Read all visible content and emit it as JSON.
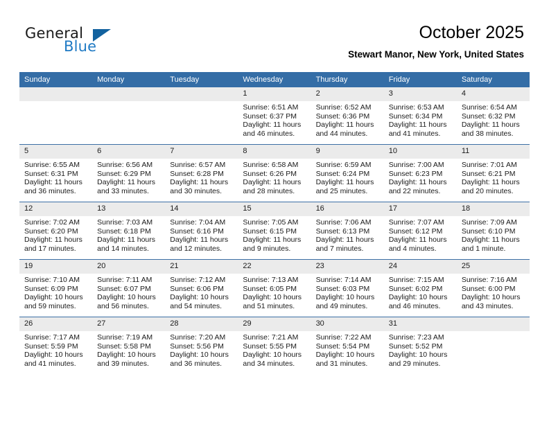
{
  "brand": {
    "word_general": "General",
    "word_blue": "Blue",
    "triangle_color": "#12629f",
    "blue_color": "#1f7ac4"
  },
  "header": {
    "title": "October 2025",
    "location": "Stewart Manor, New York, United States"
  },
  "colors": {
    "header_row_bg": "#346DA6",
    "daynum_bg": "#ebebeb",
    "row_divider": "#3b6ea5"
  },
  "weekdays": [
    "Sunday",
    "Monday",
    "Tuesday",
    "Wednesday",
    "Thursday",
    "Friday",
    "Saturday"
  ],
  "weeks": [
    [
      {
        "day": "",
        "sunrise": "",
        "sunset": "",
        "daylight1": "",
        "daylight2": ""
      },
      {
        "day": "",
        "sunrise": "",
        "sunset": "",
        "daylight1": "",
        "daylight2": ""
      },
      {
        "day": "",
        "sunrise": "",
        "sunset": "",
        "daylight1": "",
        "daylight2": ""
      },
      {
        "day": "1",
        "sunrise": "Sunrise: 6:51 AM",
        "sunset": "Sunset: 6:37 PM",
        "daylight1": "Daylight: 11 hours",
        "daylight2": "and 46 minutes."
      },
      {
        "day": "2",
        "sunrise": "Sunrise: 6:52 AM",
        "sunset": "Sunset: 6:36 PM",
        "daylight1": "Daylight: 11 hours",
        "daylight2": "and 44 minutes."
      },
      {
        "day": "3",
        "sunrise": "Sunrise: 6:53 AM",
        "sunset": "Sunset: 6:34 PM",
        "daylight1": "Daylight: 11 hours",
        "daylight2": "and 41 minutes."
      },
      {
        "day": "4",
        "sunrise": "Sunrise: 6:54 AM",
        "sunset": "Sunset: 6:32 PM",
        "daylight1": "Daylight: 11 hours",
        "daylight2": "and 38 minutes."
      }
    ],
    [
      {
        "day": "5",
        "sunrise": "Sunrise: 6:55 AM",
        "sunset": "Sunset: 6:31 PM",
        "daylight1": "Daylight: 11 hours",
        "daylight2": "and 36 minutes."
      },
      {
        "day": "6",
        "sunrise": "Sunrise: 6:56 AM",
        "sunset": "Sunset: 6:29 PM",
        "daylight1": "Daylight: 11 hours",
        "daylight2": "and 33 minutes."
      },
      {
        "day": "7",
        "sunrise": "Sunrise: 6:57 AM",
        "sunset": "Sunset: 6:28 PM",
        "daylight1": "Daylight: 11 hours",
        "daylight2": "and 30 minutes."
      },
      {
        "day": "8",
        "sunrise": "Sunrise: 6:58 AM",
        "sunset": "Sunset: 6:26 PM",
        "daylight1": "Daylight: 11 hours",
        "daylight2": "and 28 minutes."
      },
      {
        "day": "9",
        "sunrise": "Sunrise: 6:59 AM",
        "sunset": "Sunset: 6:24 PM",
        "daylight1": "Daylight: 11 hours",
        "daylight2": "and 25 minutes."
      },
      {
        "day": "10",
        "sunrise": "Sunrise: 7:00 AM",
        "sunset": "Sunset: 6:23 PM",
        "daylight1": "Daylight: 11 hours",
        "daylight2": "and 22 minutes."
      },
      {
        "day": "11",
        "sunrise": "Sunrise: 7:01 AM",
        "sunset": "Sunset: 6:21 PM",
        "daylight1": "Daylight: 11 hours",
        "daylight2": "and 20 minutes."
      }
    ],
    [
      {
        "day": "12",
        "sunrise": "Sunrise: 7:02 AM",
        "sunset": "Sunset: 6:20 PM",
        "daylight1": "Daylight: 11 hours",
        "daylight2": "and 17 minutes."
      },
      {
        "day": "13",
        "sunrise": "Sunrise: 7:03 AM",
        "sunset": "Sunset: 6:18 PM",
        "daylight1": "Daylight: 11 hours",
        "daylight2": "and 14 minutes."
      },
      {
        "day": "14",
        "sunrise": "Sunrise: 7:04 AM",
        "sunset": "Sunset: 6:16 PM",
        "daylight1": "Daylight: 11 hours",
        "daylight2": "and 12 minutes."
      },
      {
        "day": "15",
        "sunrise": "Sunrise: 7:05 AM",
        "sunset": "Sunset: 6:15 PM",
        "daylight1": "Daylight: 11 hours",
        "daylight2": "and 9 minutes."
      },
      {
        "day": "16",
        "sunrise": "Sunrise: 7:06 AM",
        "sunset": "Sunset: 6:13 PM",
        "daylight1": "Daylight: 11 hours",
        "daylight2": "and 7 minutes."
      },
      {
        "day": "17",
        "sunrise": "Sunrise: 7:07 AM",
        "sunset": "Sunset: 6:12 PM",
        "daylight1": "Daylight: 11 hours",
        "daylight2": "and 4 minutes."
      },
      {
        "day": "18",
        "sunrise": "Sunrise: 7:09 AM",
        "sunset": "Sunset: 6:10 PM",
        "daylight1": "Daylight: 11 hours",
        "daylight2": "and 1 minute."
      }
    ],
    [
      {
        "day": "19",
        "sunrise": "Sunrise: 7:10 AM",
        "sunset": "Sunset: 6:09 PM",
        "daylight1": "Daylight: 10 hours",
        "daylight2": "and 59 minutes."
      },
      {
        "day": "20",
        "sunrise": "Sunrise: 7:11 AM",
        "sunset": "Sunset: 6:07 PM",
        "daylight1": "Daylight: 10 hours",
        "daylight2": "and 56 minutes."
      },
      {
        "day": "21",
        "sunrise": "Sunrise: 7:12 AM",
        "sunset": "Sunset: 6:06 PM",
        "daylight1": "Daylight: 10 hours",
        "daylight2": "and 54 minutes."
      },
      {
        "day": "22",
        "sunrise": "Sunrise: 7:13 AM",
        "sunset": "Sunset: 6:05 PM",
        "daylight1": "Daylight: 10 hours",
        "daylight2": "and 51 minutes."
      },
      {
        "day": "23",
        "sunrise": "Sunrise: 7:14 AM",
        "sunset": "Sunset: 6:03 PM",
        "daylight1": "Daylight: 10 hours",
        "daylight2": "and 49 minutes."
      },
      {
        "day": "24",
        "sunrise": "Sunrise: 7:15 AM",
        "sunset": "Sunset: 6:02 PM",
        "daylight1": "Daylight: 10 hours",
        "daylight2": "and 46 minutes."
      },
      {
        "day": "25",
        "sunrise": "Sunrise: 7:16 AM",
        "sunset": "Sunset: 6:00 PM",
        "daylight1": "Daylight: 10 hours",
        "daylight2": "and 43 minutes."
      }
    ],
    [
      {
        "day": "26",
        "sunrise": "Sunrise: 7:17 AM",
        "sunset": "Sunset: 5:59 PM",
        "daylight1": "Daylight: 10 hours",
        "daylight2": "and 41 minutes."
      },
      {
        "day": "27",
        "sunrise": "Sunrise: 7:19 AM",
        "sunset": "Sunset: 5:58 PM",
        "daylight1": "Daylight: 10 hours",
        "daylight2": "and 39 minutes."
      },
      {
        "day": "28",
        "sunrise": "Sunrise: 7:20 AM",
        "sunset": "Sunset: 5:56 PM",
        "daylight1": "Daylight: 10 hours",
        "daylight2": "and 36 minutes."
      },
      {
        "day": "29",
        "sunrise": "Sunrise: 7:21 AM",
        "sunset": "Sunset: 5:55 PM",
        "daylight1": "Daylight: 10 hours",
        "daylight2": "and 34 minutes."
      },
      {
        "day": "30",
        "sunrise": "Sunrise: 7:22 AM",
        "sunset": "Sunset: 5:54 PM",
        "daylight1": "Daylight: 10 hours",
        "daylight2": "and 31 minutes."
      },
      {
        "day": "31",
        "sunrise": "Sunrise: 7:23 AM",
        "sunset": "Sunset: 5:52 PM",
        "daylight1": "Daylight: 10 hours",
        "daylight2": "and 29 minutes."
      },
      {
        "day": "",
        "sunrise": "",
        "sunset": "",
        "daylight1": "",
        "daylight2": ""
      }
    ]
  ]
}
